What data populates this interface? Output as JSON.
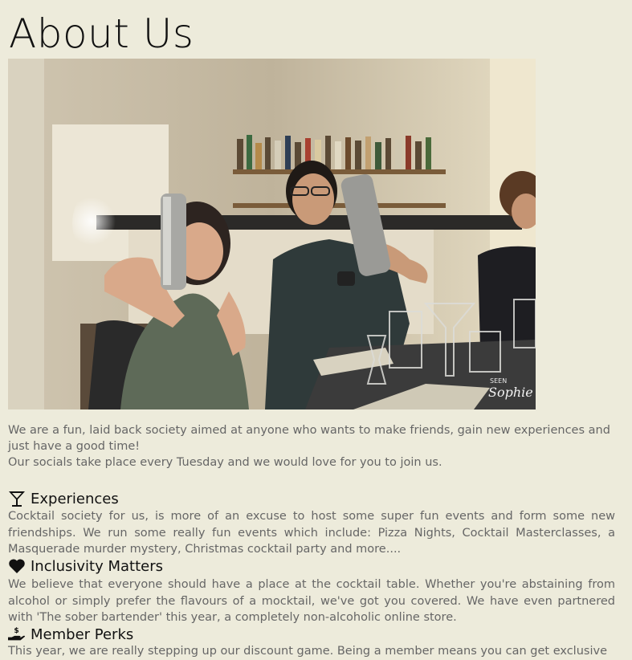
{
  "page": {
    "title": "About Us",
    "photo": {
      "watermark": "Sophie",
      "watermark_small": "SEEN"
    }
  },
  "intro": {
    "line1": "We are a fun, laid back society aimed at anyone who wants to make friends, gain new experiences and just have a good time!",
    "line2": "Our socials take place every Tuesday and we would love for you to join us."
  },
  "sections": [
    {
      "icon": "cocktail-glass-icon",
      "heading": "Experiences",
      "body": "Cocktail society for us, is more of an excuse to host some super fun events and form some new friendships. We run some really fun events which include: Pizza Nights, Cocktail Masterclasses, a Masquerade murder mystery, Christmas cocktail party and more...."
    },
    {
      "icon": "heart-icon",
      "heading": "Inclusivity Matters",
      "body": "We believe that everyone should have a place at the cocktail table. Whether you're abstaining from alcohol or simply prefer the flavours of a mocktail, we've got you covered. We have even partnered with 'The sober bartender' this year, a completely non-alcoholic online store."
    },
    {
      "icon": "hand-holding-dollar-icon",
      "heading": "Member Perks",
      "body": "This year, we are really stepping up our discount game. Being a member means you can get exclusive"
    }
  ],
  "colors": {
    "background": "#edebdb",
    "heading": "#111111",
    "body_text": "#666666"
  }
}
